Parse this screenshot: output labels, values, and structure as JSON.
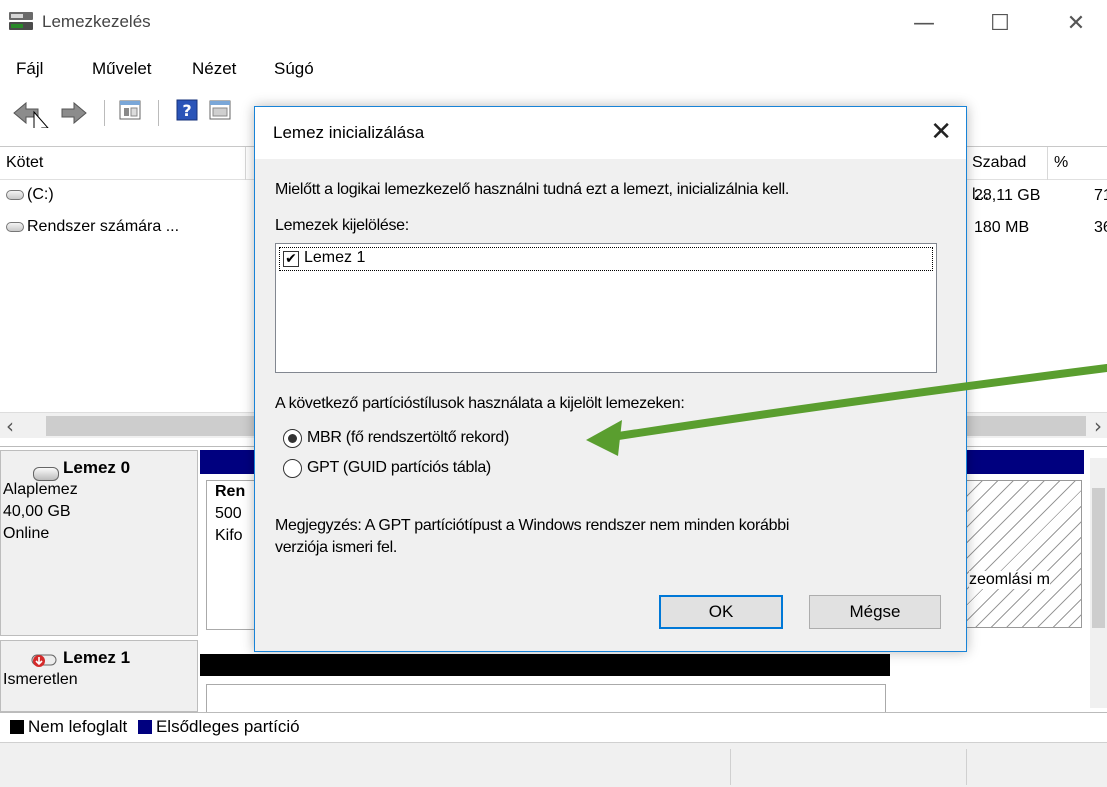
{
  "window": {
    "title": "Lemezkezelés",
    "minimize_glyph": "—",
    "maximize_glyph": "☐",
    "close_glyph": "✕"
  },
  "menu": [
    "Fájl",
    "Művelet",
    "Nézet",
    "Súgó"
  ],
  "volume_list": {
    "columns": {
      "kotet": "Kötet",
      "szabad": "Szabad l...",
      "pct": "%"
    },
    "rows": [
      {
        "name": "(C:)",
        "free": "28,11 GB",
        "pct": "71"
      },
      {
        "name": "Rendszer számára ...",
        "free": "180 MB",
        "pct": "36"
      }
    ],
    "scroll_left": "‹",
    "scroll_right": "›"
  },
  "disks": [
    {
      "name": "Lemez 0",
      "type": "Alaplemez",
      "size": "40,00 GB",
      "status": "Online",
      "partition_lines": [
        "Ren",
        "500",
        "Kifo"
      ],
      "right_partition_text": "zeomlási m"
    },
    {
      "name": "Lemez 1",
      "type": "Ismeretlen"
    }
  ],
  "legend": {
    "unallocated": "Nem lefoglalt",
    "primary": "Elsődleges partíció"
  },
  "colors": {
    "primary": "#00007f",
    "unallocated": "#000000",
    "accent": "#0078d7",
    "arrow": "#5a9e2f"
  },
  "dialog": {
    "title": "Lemez inicializálása",
    "close_glyph": "✕",
    "intro": "Mielőtt a logikai lemezkezelő használni tudná ezt a lemezt, inicializálnia kell.",
    "select_label": "Lemezek kijelölése:",
    "disk_item": "Lemez 1",
    "disk_checked": true,
    "check_glyph": "✔",
    "style_label": "A következő partícióstílusok használata a kijelölt lemezeken:",
    "option_mbr": "MBR (fő rendszertöltő rekord)",
    "option_gpt": "GPT (GUID partíciós tábla)",
    "selected_option": "MBR",
    "note_line1": "Megjegyzés: A GPT partíciótípust a Windows rendszer nem minden korábbi",
    "note_line2": "verziója ismeri fel.",
    "ok": "OK",
    "cancel": "Mégse"
  }
}
